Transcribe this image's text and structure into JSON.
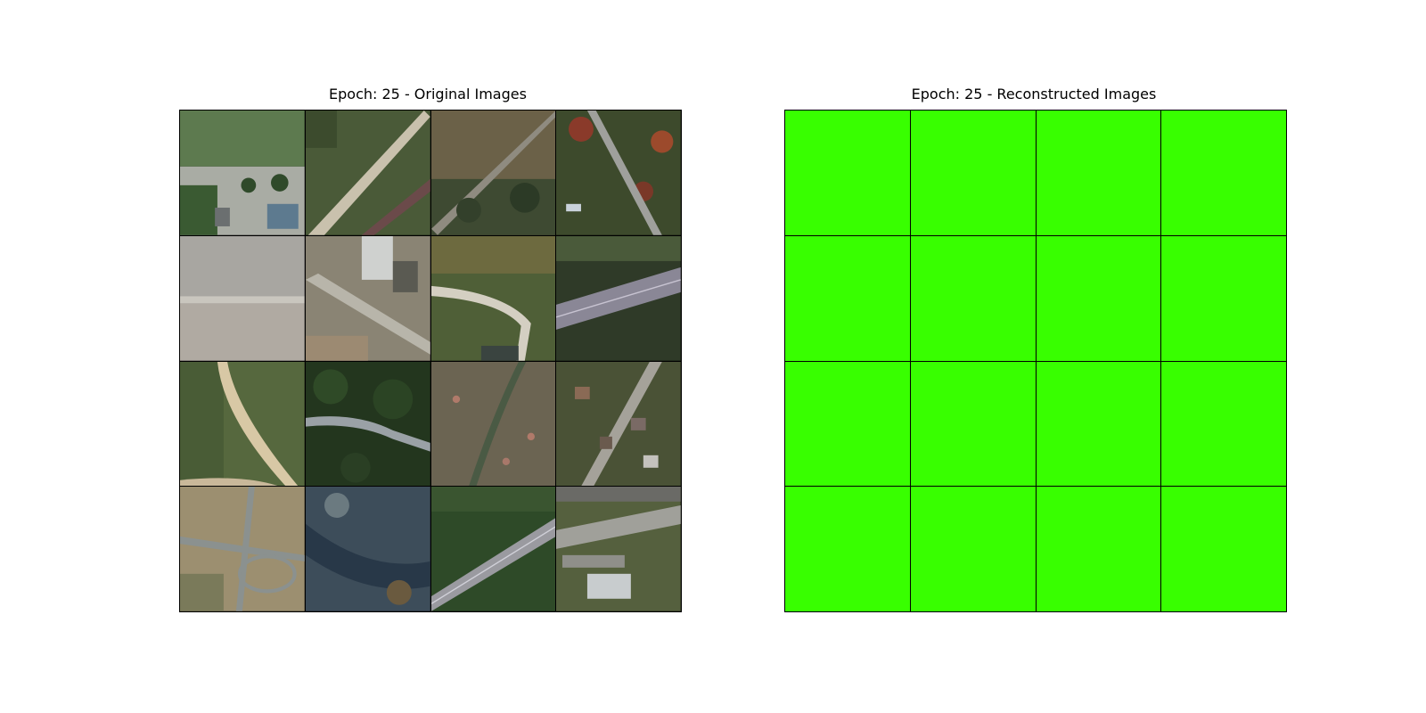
{
  "left_panel": {
    "title": "Epoch: 25 - Original Images",
    "tiles": [
      {
        "label": "aerial-farm-buildings"
      },
      {
        "label": "aerial-diagonal-road-grass"
      },
      {
        "label": "aerial-forest-trail"
      },
      {
        "label": "aerial-autumn-forest-road"
      },
      {
        "label": "aerial-plowed-field"
      },
      {
        "label": "aerial-industrial-road"
      },
      {
        "label": "aerial-curved-road-junction"
      },
      {
        "label": "aerial-highway-forest"
      },
      {
        "label": "aerial-curved-dirt-road-field"
      },
      {
        "label": "aerial-dense-forest-road"
      },
      {
        "label": "aerial-sparse-woods"
      },
      {
        "label": "aerial-residential-houses"
      },
      {
        "label": "aerial-rural-crossroads"
      },
      {
        "label": "aerial-river-forest"
      },
      {
        "label": "aerial-highway-green"
      },
      {
        "label": "aerial-parking-highway"
      }
    ]
  },
  "right_panel": {
    "title": "Epoch: 25 - Reconstructed Images",
    "tile_color": "#38ff00",
    "tile_count": 16
  }
}
